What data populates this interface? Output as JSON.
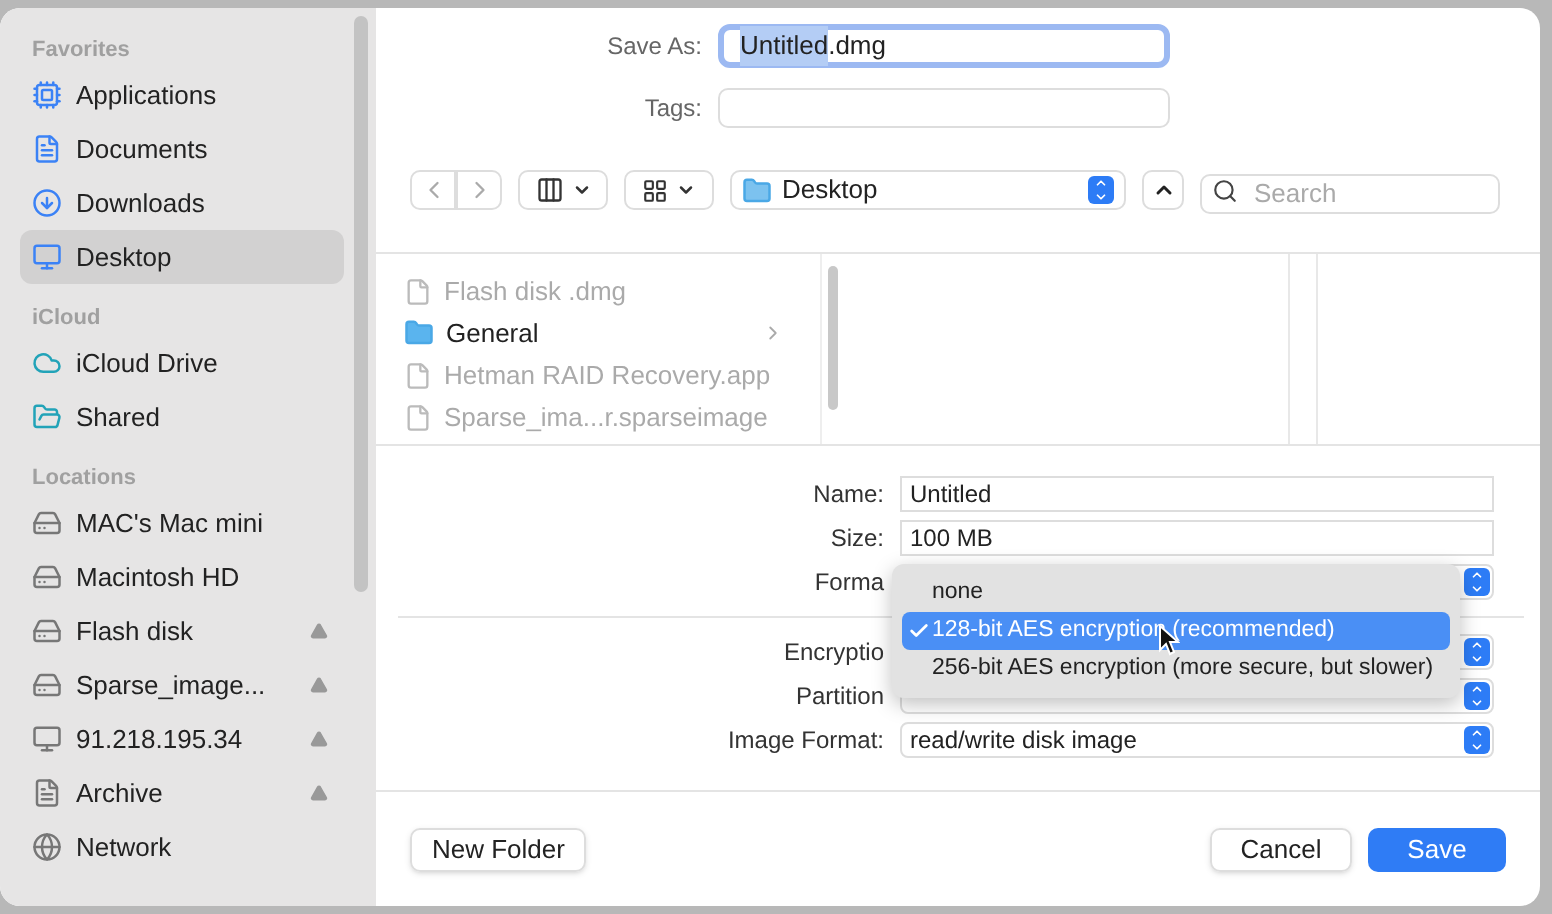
{
  "sidebar": {
    "sections": [
      {
        "title": "Favorites",
        "items": [
          {
            "label": "Applications",
            "selected": false,
            "eject": false
          },
          {
            "label": "Documents",
            "selected": false,
            "eject": false
          },
          {
            "label": "Downloads",
            "selected": false,
            "eject": false
          },
          {
            "label": "Desktop",
            "selected": true,
            "eject": false
          }
        ]
      },
      {
        "title": "iCloud",
        "items": [
          {
            "label": "iCloud Drive",
            "selected": false,
            "eject": false
          },
          {
            "label": "Shared",
            "selected": false,
            "eject": false
          }
        ]
      },
      {
        "title": "Locations",
        "items": [
          {
            "label": "MAC's Mac mini",
            "selected": false,
            "eject": false
          },
          {
            "label": "Macintosh HD",
            "selected": false,
            "eject": false
          },
          {
            "label": "Flash disk",
            "selected": false,
            "eject": true
          },
          {
            "label": "Sparse_image...",
            "selected": false,
            "eject": true
          },
          {
            "label": "91.218.195.34",
            "selected": false,
            "eject": true
          },
          {
            "label": "Archive",
            "selected": false,
            "eject": true
          },
          {
            "label": "Network",
            "selected": false,
            "eject": false
          }
        ]
      }
    ]
  },
  "save_as": {
    "label": "Save As:",
    "value_selected": "Untitled",
    "value_rest": ".dmg"
  },
  "tags": {
    "label": "Tags:"
  },
  "toolbar": {
    "location": "Desktop",
    "search": {
      "placeholder": "Search"
    }
  },
  "files": [
    {
      "name": "Flash disk .dmg",
      "kind": "file",
      "disabled": true
    },
    {
      "name": "General",
      "kind": "folder",
      "disabled": false
    },
    {
      "name": "Hetman RAID Recovery.app",
      "kind": "app",
      "disabled": true
    },
    {
      "name": "Sparse_ima...r.sparseimage",
      "kind": "file",
      "disabled": true
    }
  ],
  "form": [
    {
      "label": "Name:",
      "kind": "text",
      "value": "Untitled"
    },
    {
      "label": "Size:",
      "kind": "text",
      "value": "100 MB"
    },
    {
      "label": "Forma",
      "kind": "popup"
    },
    {
      "kind": "divider"
    },
    {
      "label": "Encryptio",
      "kind": "popup"
    },
    {
      "label": "Partition",
      "kind": "popup"
    },
    {
      "label": "Image Format:",
      "kind": "popup",
      "value": "read/write disk image"
    }
  ],
  "menu": [
    {
      "label": "none",
      "selected": false
    },
    {
      "label": "128-bit AES encryption (recommended)",
      "selected": true
    },
    {
      "label": "256-bit AES encryption (more secure, but slower)",
      "selected": false
    }
  ],
  "buttons": {
    "new_folder": "New Folder",
    "cancel": "Cancel",
    "save": "Save"
  }
}
